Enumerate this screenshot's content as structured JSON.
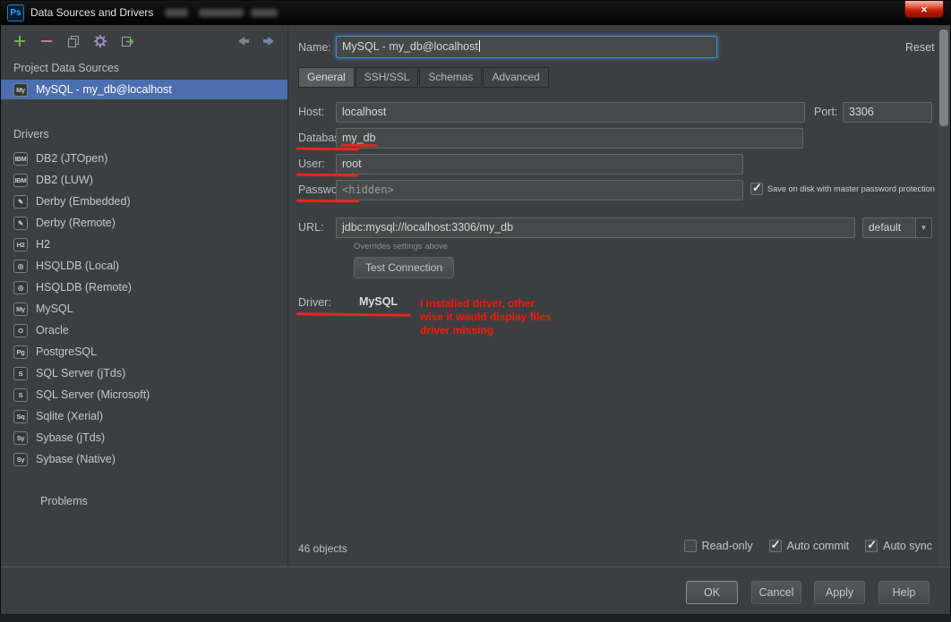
{
  "title_bar": {
    "app_badge": "Ps",
    "title": "Data Sources and Drivers",
    "close_glyph": "×"
  },
  "left_panel": {
    "project_section_label": "Project Data Sources",
    "selected_source": {
      "icon": "My",
      "label": "MySQL - my_db@localhost"
    },
    "drivers_section_label": "Drivers",
    "drivers": [
      {
        "icon": "IBM",
        "label": "DB2 (JTOpen)"
      },
      {
        "icon": "IBM",
        "label": "DB2 (LUW)"
      },
      {
        "icon": "✎",
        "label": "Derby (Embedded)"
      },
      {
        "icon": "✎",
        "label": "Derby (Remote)"
      },
      {
        "icon": "H2",
        "label": "H2"
      },
      {
        "icon": "◎",
        "label": "HSQLDB (Local)"
      },
      {
        "icon": "◎",
        "label": "HSQLDB (Remote)"
      },
      {
        "icon": "My",
        "label": "MySQL"
      },
      {
        "icon": "O",
        "label": "Oracle"
      },
      {
        "icon": "Pg",
        "label": "PostgreSQL"
      },
      {
        "icon": "S",
        "label": "SQL Server (jTds)"
      },
      {
        "icon": "S",
        "label": "SQL Server (Microsoft)"
      },
      {
        "icon": "Sq",
        "label": "Sqlite (Xerial)"
      },
      {
        "icon": "Sy",
        "label": "Sybase (jTds)"
      },
      {
        "icon": "Sy",
        "label": "Sybase (Native)"
      }
    ],
    "problems_label": "Problems"
  },
  "form": {
    "name_label": "Name:",
    "name_value": "MySQL - my_db@localhost",
    "reset_label": "Reset",
    "tabs": [
      {
        "label": "General"
      },
      {
        "label": "SSH/SSL"
      },
      {
        "label": "Schemas"
      },
      {
        "label": "Advanced"
      }
    ],
    "host_label": "Host:",
    "host_value": "localhost",
    "port_label": "Port:",
    "port_value": "3306",
    "database_label": "Database:",
    "database_value": "my_db",
    "user_label": "User:",
    "user_value": "root",
    "password_label": "Password:",
    "password_value": "<hidden>",
    "save_password_label": "Save on disk with master password protection",
    "url_label": "URL:",
    "url_value": "jdbc:mysql://localhost:3306/my_db",
    "url_preset": "default",
    "combo_arrow_glyph": "▼",
    "url_hint": "Overrides settings above",
    "test_connection_label": "Test Connection",
    "driver_label": "Driver:",
    "driver_value": "MySQL",
    "objects_count": "46 objects",
    "read_only_label": "Read-only",
    "auto_commit_label": "Auto commit",
    "auto_sync_label": "Auto sync",
    "check_glyph": "✓"
  },
  "annotations": {
    "lines": [
      "I installed driver,  other",
      "wise it would display files",
      "driver missing"
    ]
  },
  "footer": {
    "ok": "OK",
    "cancel": "Cancel",
    "apply": "Apply",
    "help": "Help"
  }
}
